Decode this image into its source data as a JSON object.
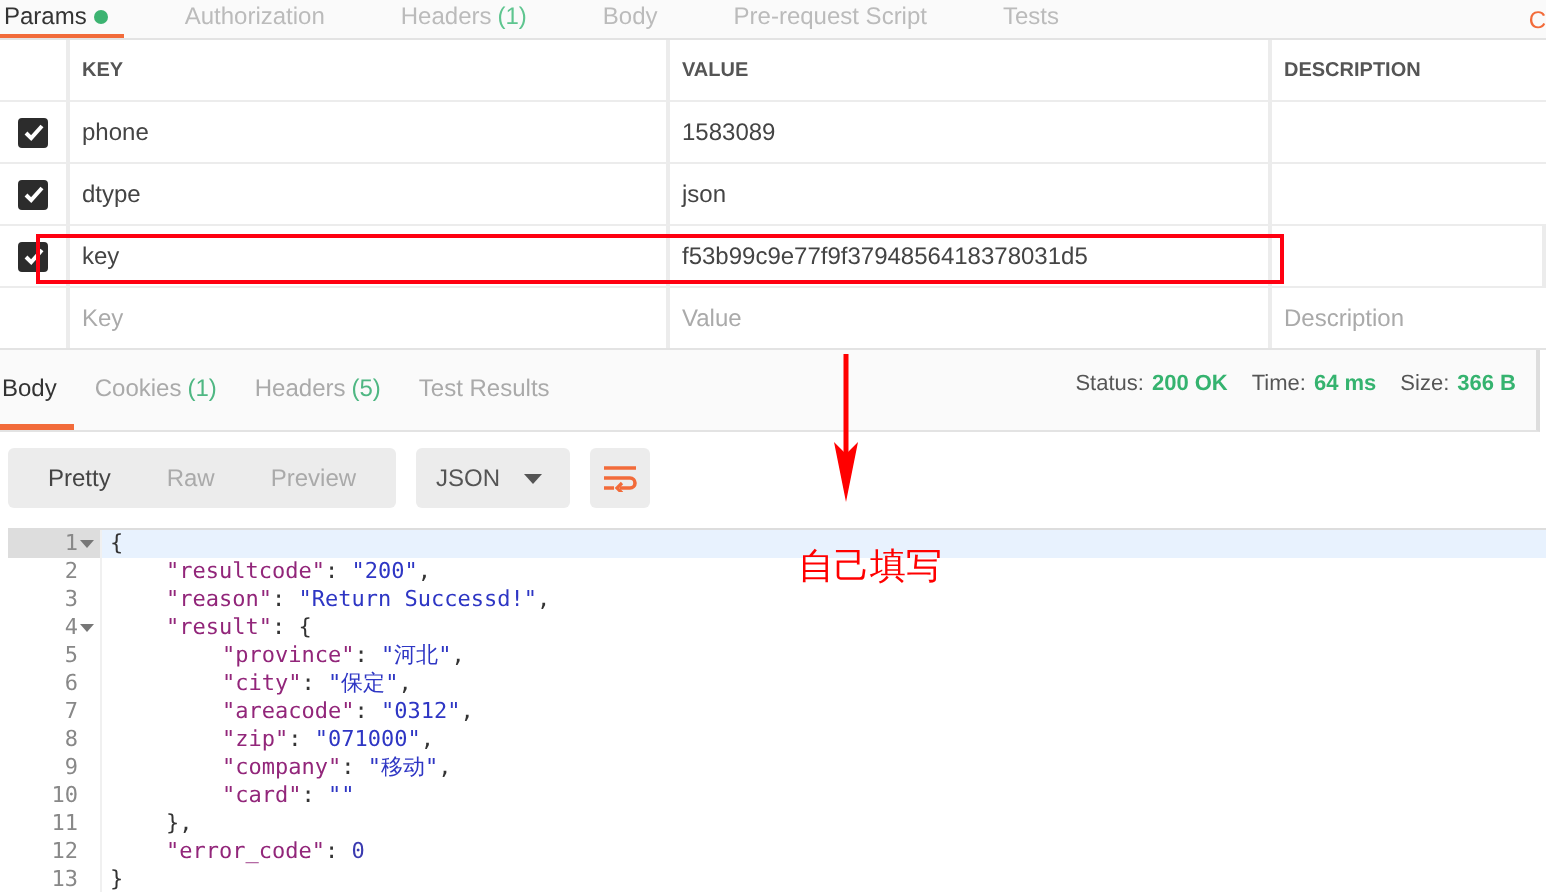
{
  "request_tabs": [
    {
      "label": "Params",
      "dot": true,
      "selected": true
    },
    {
      "label": "Authorization",
      "dot": false,
      "selected": false
    },
    {
      "label": "Headers",
      "dot": false,
      "count": "(1)",
      "selected": false
    },
    {
      "label": "Body",
      "dot": false,
      "selected": false
    },
    {
      "label": "Pre-request Script",
      "dot": false,
      "selected": false
    },
    {
      "label": "Tests",
      "dot": false,
      "selected": false
    }
  ],
  "cut_link": "C",
  "params_table": {
    "columns": [
      "KEY",
      "VALUE",
      "DESCRIPTION"
    ],
    "rows": [
      {
        "checked": true,
        "key": "phone",
        "value": "1583089"
      },
      {
        "checked": true,
        "key": "dtype",
        "value": "json"
      },
      {
        "checked": true,
        "key": "key",
        "value": "f53b99c9e77f9f3794856418378031d5",
        "highlighted": true
      }
    ],
    "placeholders": {
      "key": "Key",
      "value": "Value",
      "description": "Description"
    }
  },
  "response_tabs": [
    {
      "label": "Body",
      "selected": true
    },
    {
      "label": "Cookies",
      "count": "(1)",
      "selected": false
    },
    {
      "label": "Headers",
      "count": "(5)",
      "selected": false
    },
    {
      "label": "Test Results",
      "selected": false
    }
  ],
  "status": [
    {
      "label": "Status:",
      "value": "200 OK"
    },
    {
      "label": "Time:",
      "value": "64 ms"
    },
    {
      "label": "Size:",
      "value": "366 B"
    }
  ],
  "view_modes": [
    {
      "label": "Pretty",
      "selected": true
    },
    {
      "label": "Raw",
      "selected": false
    },
    {
      "label": "Preview",
      "selected": false
    }
  ],
  "format": "JSON",
  "code_lines": [
    {
      "n": "1",
      "fold": true,
      "current": true,
      "tokens": [
        {
          "kind": "punct",
          "text": "{"
        }
      ],
      "children": [
        {
          "n": "2",
          "fold": false,
          "current": false,
          "tokens": [
            {
              "kind": "key",
              "text": "\"resultcode\""
            },
            {
              "kind": "punct",
              "text": ": "
            },
            {
              "kind": "string",
              "text": "\"200\""
            },
            {
              "kind": "punct",
              "text": ","
            }
          ]
        },
        {
          "n": "3",
          "fold": false,
          "current": false,
          "tokens": [
            {
              "kind": "key",
              "text": "\"reason\""
            },
            {
              "kind": "punct",
              "text": ": "
            },
            {
              "kind": "string",
              "text": "\"Return Successd!\""
            },
            {
              "kind": "punct",
              "text": ","
            }
          ]
        },
        {
          "n": "4",
          "fold": true,
          "current": false,
          "tokens": [
            {
              "kind": "key",
              "text": "\"result\""
            },
            {
              "kind": "punct",
              "text": ": {"
            }
          ],
          "children": [
            {
              "n": "5",
              "fold": false,
              "current": false,
              "tokens": [
                {
                  "kind": "key",
                  "text": "\"province\""
                },
                {
                  "kind": "punct",
                  "text": ": "
                },
                {
                  "kind": "string",
                  "text": "\"河北\""
                },
                {
                  "kind": "punct",
                  "text": ","
                }
              ]
            },
            {
              "n": "6",
              "fold": false,
              "current": false,
              "tokens": [
                {
                  "kind": "key",
                  "text": "\"city\""
                },
                {
                  "kind": "punct",
                  "text": ": "
                },
                {
                  "kind": "string",
                  "text": "\"保定\""
                },
                {
                  "kind": "punct",
                  "text": ","
                }
              ]
            },
            {
              "n": "7",
              "fold": false,
              "current": false,
              "tokens": [
                {
                  "kind": "key",
                  "text": "\"areacode\""
                },
                {
                  "kind": "punct",
                  "text": ": "
                },
                {
                  "kind": "string",
                  "text": "\"0312\""
                },
                {
                  "kind": "punct",
                  "text": ","
                }
              ]
            },
            {
              "n": "8",
              "fold": false,
              "current": false,
              "tokens": [
                {
                  "kind": "key",
                  "text": "\"zip\""
                },
                {
                  "kind": "punct",
                  "text": ": "
                },
                {
                  "kind": "string",
                  "text": "\"071000\""
                },
                {
                  "kind": "punct",
                  "text": ","
                }
              ]
            },
            {
              "n": "9",
              "fold": false,
              "current": false,
              "tokens": [
                {
                  "kind": "key",
                  "text": "\"company\""
                },
                {
                  "kind": "punct",
                  "text": ": "
                },
                {
                  "kind": "string",
                  "text": "\"移动\""
                },
                {
                  "kind": "punct",
                  "text": ","
                }
              ]
            },
            {
              "n": "10",
              "fold": false,
              "current": false,
              "tokens": [
                {
                  "kind": "key",
                  "text": "\"card\""
                },
                {
                  "kind": "punct",
                  "text": ": "
                },
                {
                  "kind": "string",
                  "text": "\"\""
                }
              ]
            }
          ]
        },
        {
          "n": "11",
          "fold": false,
          "current": false,
          "tokens": [
            {
              "kind": "punct",
              "text": "},"
            }
          ]
        },
        {
          "n": "12",
          "fold": false,
          "current": false,
          "tokens": [
            {
              "kind": "key",
              "text": "\"error_code\""
            },
            {
              "kind": "punct",
              "text": ": "
            },
            {
              "kind": "number",
              "text": "0"
            }
          ]
        }
      ]
    },
    {
      "n": "13",
      "fold": false,
      "current": false,
      "tokens": [
        {
          "kind": "punct",
          "text": "}"
        }
      ]
    }
  ],
  "annotation": {
    "text": "自己填写"
  }
}
